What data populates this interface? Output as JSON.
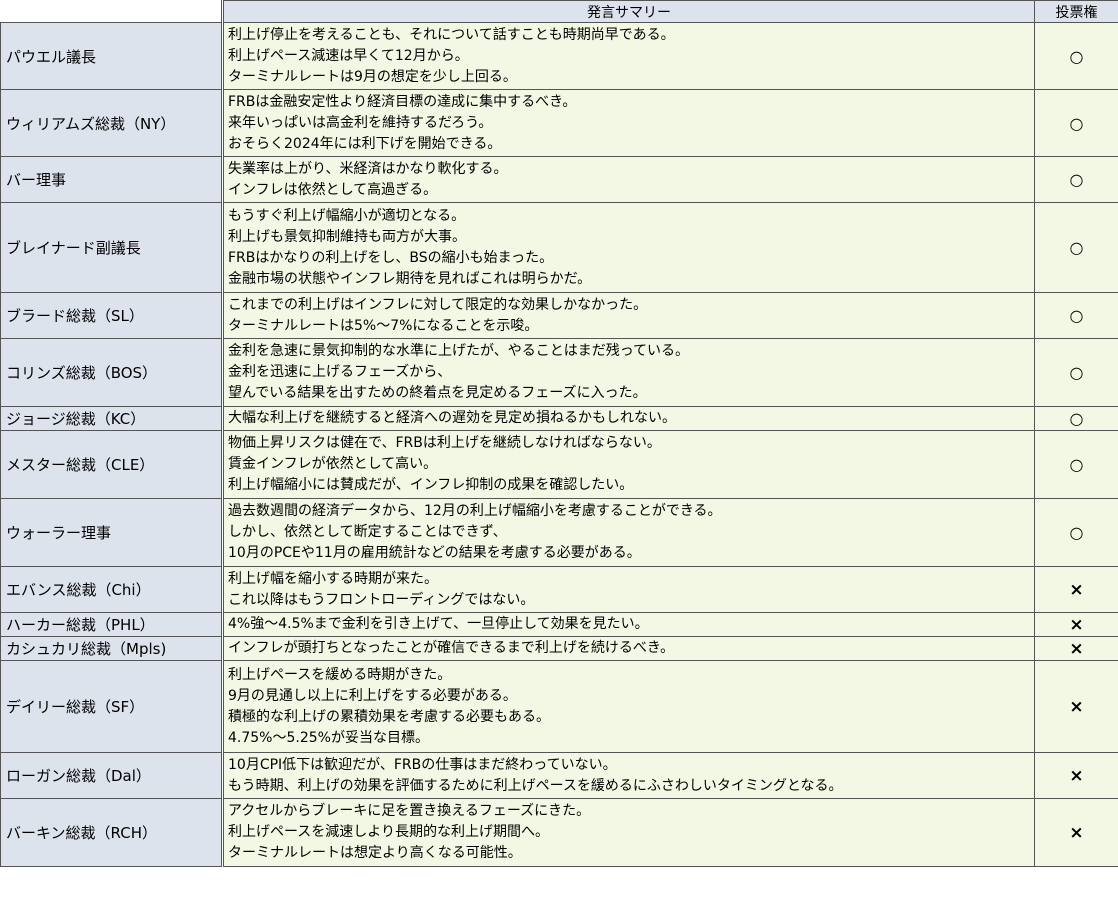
{
  "header": {
    "summary": "発言サマリー",
    "vote": "投票権"
  },
  "rows": [
    {
      "name": "パウエル議長",
      "lines": [
        "利上げ停止を考えることも、それについて話すことも時期尚早である。",
        "利上げペース減速は早くて12月から。",
        "ターミナルレートは9月の想定を少し上回る。"
      ],
      "vote": "○"
    },
    {
      "name": "ウィリアムズ総裁（NY）",
      "lines": [
        "FRBは金融安定性より経済目標の達成に集中するべき。",
        "来年いっぱいは高金利を維持するだろう。",
        "おそらく2024年には利下げを開始できる。"
      ],
      "vote": "○"
    },
    {
      "name": "バー理事",
      "lines": [
        "失業率は上がり、米経済はかなり軟化する。",
        "インフレは依然として高過ぎる。"
      ],
      "vote": "○"
    },
    {
      "name": "ブレイナード副議長",
      "lines": [
        "もうすぐ利上げ幅縮小が適切となる。",
        "利上げも景気抑制維持も両方が大事。",
        "FRBはかなりの利上げをし、BSの縮小も始まった。",
        "金融市場の状態やインフレ期待を見ればこれは明らかだ。"
      ],
      "vote": "○"
    },
    {
      "name": "ブラード総裁（SL）",
      "lines": [
        "これまでの利上げはインフレに対して限定的な効果しかなかった。",
        "ターミナルレートは5%～7%になることを示唆。"
      ],
      "vote": "○"
    },
    {
      "name": "コリンズ総裁（BOS）",
      "lines": [
        "金利を急速に景気抑制的な水準に上げたが、やることはまだ残っている。",
        "金利を迅速に上げるフェーズから、",
        "望んでいる結果を出すための終着点を見定めるフェーズに入った。"
      ],
      "vote": "○"
    },
    {
      "name": "ジョージ総裁（KC）",
      "lines": [
        "大幅な利上げを継続すると経済への遅効を見定め損ねるかもしれない。"
      ],
      "vote": "○"
    },
    {
      "name": "メスター総裁（CLE）",
      "lines": [
        "物価上昇リスクは健在で、FRBは利上げを継続しなければならない。",
        "賃金インフレが依然として高い。",
        "利上げ幅縮小には賛成だが、インフレ抑制の成果を確認したい。"
      ],
      "vote": "○"
    },
    {
      "name": "ウォーラー理事",
      "lines": [
        "過去数週間の経済データから、12月の利上げ幅縮小を考慮することができる。",
        "しかし、依然として断定することはできず、",
        "10月のPCEや11月の雇用統計などの結果を考慮する必要がある。"
      ],
      "vote": "○"
    },
    {
      "name": "エバンス総裁（Chi）",
      "lines": [
        "利上げ幅を縮小する時期が来た。",
        "これ以降はもうフロントローディングではない。"
      ],
      "vote": "×"
    },
    {
      "name": "ハーカー総裁（PHL）",
      "lines": [
        "4%強～4.5%まで金利を引き上げて、一旦停止して効果を見たい。"
      ],
      "vote": "×"
    },
    {
      "name": "カシュカリ総裁（Mpls)",
      "lines": [
        "インフレが頭打ちとなったことが確信できるまで利上げを続けるべき。"
      ],
      "vote": "×"
    },
    {
      "name": "デイリー総裁（SF）",
      "lines": [
        "利上げペースを緩める時期がきた。",
        "9月の見通し以上に利上げをする必要がある。",
        "積極的な利上げの累積効果を考慮する必要もある。",
        "4.75%～5.25%が妥当な目標。"
      ],
      "vote": "×"
    },
    {
      "name": "ローガン総裁（Dal）",
      "lines": [
        "10月CPI低下は歓迎だが、FRBの仕事はまだ終わっていない。",
        "もう時期、利上げの効果を評価するために利上げペースを緩めるにふさわしいタイミングとなる。"
      ],
      "vote": "×"
    },
    {
      "name": "バーキン総裁（RCH）",
      "lines": [
        "アクセルからブレーキに足を置き換えるフェーズにきた。",
        "利上げペースを減速しより長期的な利上げ期間へ。",
        "ターミナルレートは想定より高くなる可能性。"
      ],
      "vote": "×"
    }
  ]
}
